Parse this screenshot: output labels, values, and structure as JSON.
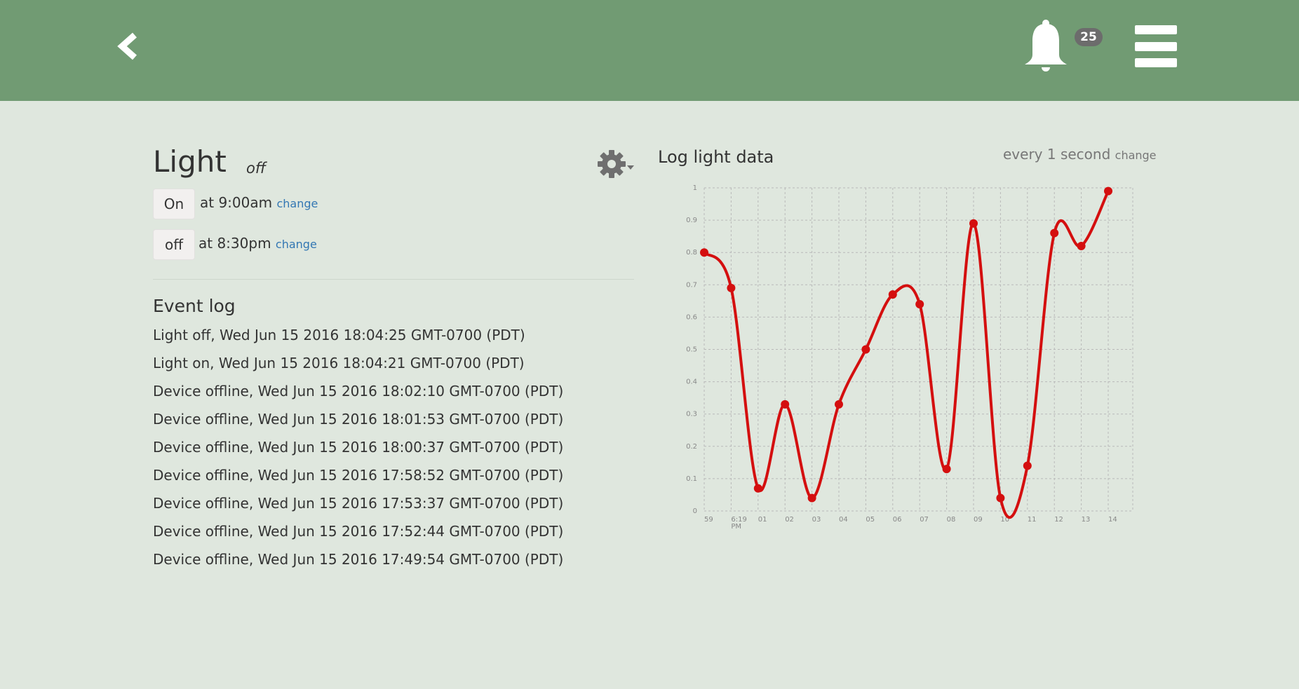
{
  "header": {
    "back_icon": "chevron-left-icon",
    "bell_icon": "bell-icon",
    "notification_count": "25",
    "menu_icon": "hamburger-menu-icon",
    "bar_color": "#719b73"
  },
  "device": {
    "name": "Light",
    "state": "off",
    "settings_icon": "gear-icon"
  },
  "schedule": [
    {
      "action_label": "On",
      "time_text": "at 9:00am",
      "change_label": "change"
    },
    {
      "action_label": "off",
      "time_text": "at 8:30pm",
      "change_label": "change"
    }
  ],
  "event_log": {
    "title": "Event log",
    "entries": [
      "Light off, Wed Jun 15 2016 18:04:25 GMT-0700 (PDT)",
      "Light on, Wed Jun 15 2016 18:04:21 GMT-0700 (PDT)",
      "Device offline, Wed Jun 15 2016 18:02:10 GMT-0700 (PDT)",
      "Device offline, Wed Jun 15 2016 18:01:53 GMT-0700 (PDT)",
      "Device offline, Wed Jun 15 2016 18:00:37 GMT-0700 (PDT)",
      "Device offline, Wed Jun 15 2016 17:58:52 GMT-0700 (PDT)",
      "Device offline, Wed Jun 15 2016 17:53:37 GMT-0700 (PDT)",
      "Device offline, Wed Jun 15 2016 17:52:44 GMT-0700 (PDT)",
      "Device offline, Wed Jun 15 2016 17:49:54 GMT-0700 (PDT)"
    ]
  },
  "chart_panel": {
    "title": "Log light data",
    "interval_text": "every 1 second",
    "change_label": "change"
  },
  "chart_data": {
    "type": "line",
    "title": "Log light data",
    "xlabel": "",
    "ylabel": "",
    "ylim": [
      0,
      1
    ],
    "y_ticks": [
      "0",
      "0.1",
      "0.2",
      "0.3",
      "0.4",
      "0.5",
      "0.6",
      "0.7",
      "0.8",
      "0.9",
      "1"
    ],
    "x_ticks": [
      "59",
      "6:19 PM",
      "01",
      "02",
      "03",
      "04",
      "05",
      "06",
      "07",
      "08",
      "09",
      "10",
      "11",
      "12",
      "13",
      "14"
    ],
    "grid": true,
    "line_color": "#d40f0f",
    "series": [
      {
        "x": [
          "18:18:59",
          "18:19:00",
          "18:19:01",
          "18:19:02",
          "18:19:03",
          "18:19:04",
          "18:19:05",
          "18:19:06",
          "18:19:07",
          "18:19:08",
          "18:19:09",
          "18:19:10",
          "18:19:11",
          "18:19:12",
          "18:19:13",
          "18:19:14"
        ],
        "values": [
          0.8,
          0.69,
          0.07,
          0.33,
          0.04,
          0.33,
          0.5,
          0.67,
          0.64,
          0.13,
          0.89,
          0.04,
          0.14,
          0.86,
          0.82,
          0.99
        ]
      }
    ]
  }
}
